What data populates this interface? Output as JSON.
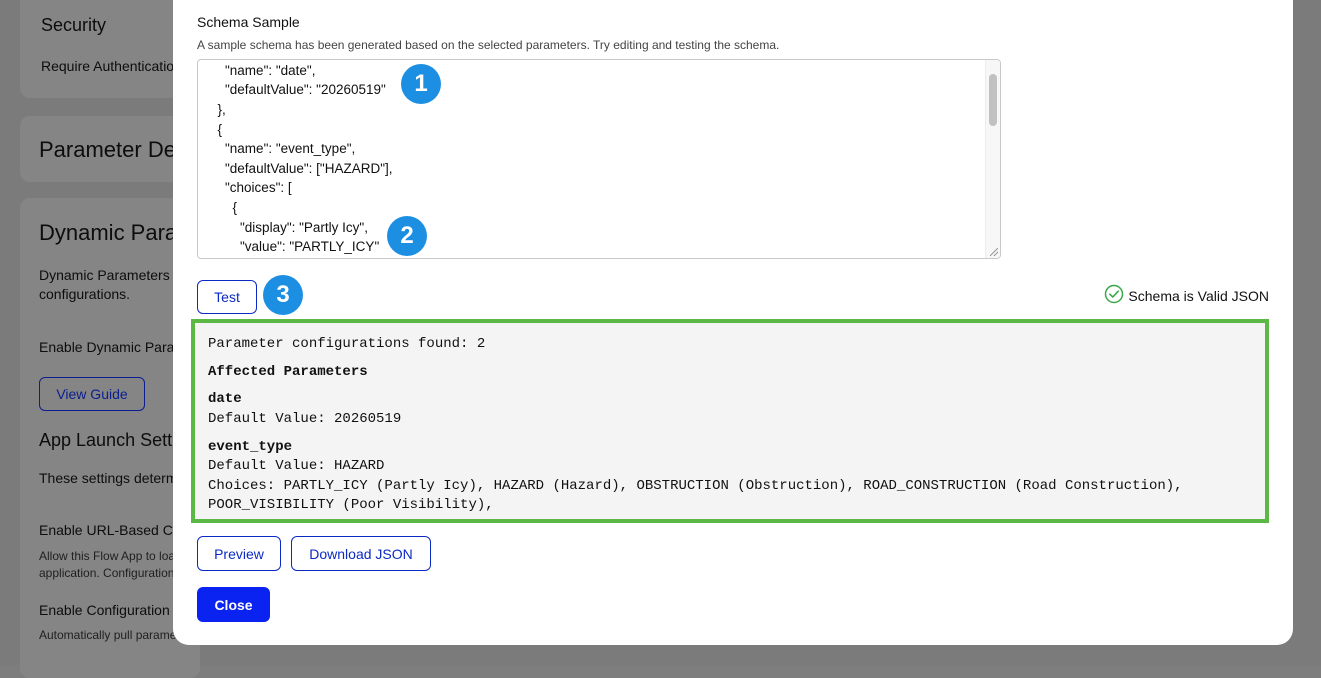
{
  "background": {
    "security_title": "Security",
    "require_auth": "Require Authenticatio",
    "param_defaults_title": "Parameter De",
    "dynamic_params_title": "Dynamic Para",
    "dynamic_params_desc_1": "Dynamic Parameters",
    "dynamic_params_desc_2": "configurations.",
    "enable_dynamic": "Enable Dynamic Para",
    "view_guide_label": "View Guide",
    "app_launch_title": "App Launch Sett",
    "app_launch_desc": "These settings determ",
    "enable_url": "Enable URL-Based Co",
    "enable_url_desc_1": "Allow this Flow App to loa",
    "enable_url_desc_2": "application. Configuration",
    "enable_config": "Enable Configuration",
    "enable_config_desc": "Automatically pull parame"
  },
  "modal": {
    "title": "Schema Sample",
    "subtitle": "A sample schema has been generated based on the selected parameters. Try editing and testing the schema.",
    "editor_lines": [
      "    \"name\": \"date\",",
      "    \"defaultValue\": \"20260519\"",
      "  },",
      "  {",
      "    \"name\": \"event_type\",",
      "    \"defaultValue\": [\"HAZARD\"],",
      "    \"choices\": [",
      "      {",
      "        \"display\": \"Partly Icy\",",
      "        \"value\": \"PARTLY_ICY\""
    ],
    "badges": [
      "1",
      "2",
      "3"
    ],
    "test_label": "Test",
    "valid_label": "Schema is Valid JSON",
    "result": {
      "found": "Parameter configurations found: 2",
      "affected_heading": "Affected Parameters",
      "param1_name": "date",
      "param1_default": "Default Value: 20260519",
      "param2_name": "event_type",
      "param2_default": "Default Value: HAZARD",
      "param2_choices_1": "Choices: PARTLY_ICY (Partly Icy), HAZARD (Hazard), OBSTRUCTION (Obstruction), ROAD_CONSTRUCTION (Road Construction),",
      "param2_choices_2": "POOR_VISIBILITY (Poor Visibility),"
    },
    "preview_label": "Preview",
    "download_label": "Download JSON",
    "close_label": "Close"
  },
  "colors": {
    "accent": "#0a23f0",
    "badge": "#1d8fe3",
    "valid_check": "#3aa84a",
    "result_border": "#5bb844"
  },
  "icons": {
    "valid": "check-circle-icon"
  }
}
